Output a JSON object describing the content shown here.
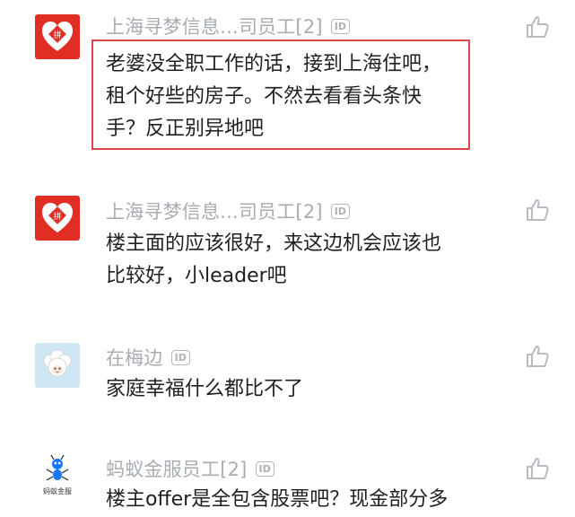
{
  "comments": [
    {
      "user": "上海寻梦信息...司员工[2]",
      "id_badge": "ID",
      "text": "老婆没全职工作的话，接到上海住吧，\n租个好些的房子。不然去看看头条快\n手？反正别异地吧",
      "avatar_icon": "pinduoduo-logo-icon",
      "highlighted": true
    },
    {
      "user": "上海寻梦信息...司员工[2]",
      "id_badge": "ID",
      "text": "楼主面的应该很好，来这边机会应该也\n比较好，小leader吧",
      "avatar_icon": "pinduoduo-logo-icon",
      "highlighted": false
    },
    {
      "user": "在梅边",
      "id_badge": "ID",
      "text": "家庭幸福什么都比不了",
      "avatar_icon": "sheep-avatar-icon",
      "highlighted": false
    },
    {
      "user": "蚂蚁金服员工[2]",
      "id_badge": "ID",
      "text": "楼主offer是全包含股票吧？现金部分多",
      "avatar_icon": "ant-financial-logo-icon",
      "avatar_caption": "蚂蚁金服",
      "highlighted": false
    }
  ],
  "colors": {
    "pinduoduo_red": "#e02e24",
    "highlight_border": "#e0454b",
    "username_gray": "#a8acb3",
    "text_dark": "#1f1f1f",
    "like_icon": "#b8bcc2"
  }
}
